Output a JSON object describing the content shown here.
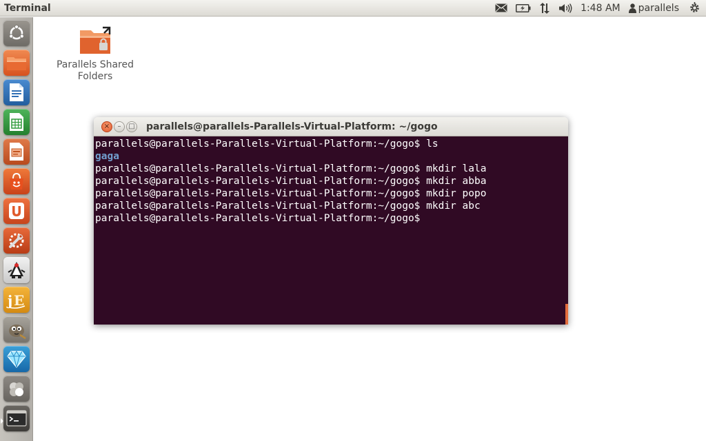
{
  "top_panel": {
    "app_title": "Terminal",
    "clock": "1:48 AM",
    "user": "parallels",
    "icons": [
      "mail-icon",
      "battery-icon",
      "network-icon",
      "volume-icon",
      "user-icon",
      "gear-icon"
    ]
  },
  "launcher": {
    "items": [
      {
        "name": "dash-home",
        "icon": "ubuntu-logo-icon"
      },
      {
        "name": "files",
        "icon": "folder-icon"
      },
      {
        "name": "libreoffice-writer",
        "icon": "document-icon"
      },
      {
        "name": "libreoffice-calc",
        "icon": "spreadsheet-icon"
      },
      {
        "name": "libreoffice-impress",
        "icon": "presentation-icon"
      },
      {
        "name": "software-center",
        "icon": "shopping-bag-icon"
      },
      {
        "name": "ubuntu-one",
        "icon": "u-logo-icon"
      },
      {
        "name": "system-settings",
        "icon": "wrench-icon"
      },
      {
        "name": "java-app",
        "icon": "java-duke-icon"
      },
      {
        "name": "jedit",
        "icon": "je-logo-icon"
      },
      {
        "name": "gimp",
        "icon": "gimp-icon"
      },
      {
        "name": "diamond-app",
        "icon": "diamond-icon"
      },
      {
        "name": "workspace-switcher",
        "icon": "workspaces-icon"
      },
      {
        "name": "terminal",
        "icon": "terminal-icon"
      }
    ],
    "colors": {
      "orange": "#e05a2b",
      "writer_blue": "#2f6fb4",
      "calc_green": "#2f9a3a"
    }
  },
  "desktop": {
    "shared_folder_label": "Parallels Shared Folders"
  },
  "terminal": {
    "title": "parallels@parallels-Parallels-Virtual-Platform: ~/gogo",
    "close_label": "×",
    "minimize_label": "–",
    "maximize_label": "□",
    "background": "#300a24",
    "lines": [
      {
        "text": "parallels@parallels-Parallels-Virtual-Platform:~/gogo$ ls",
        "kind": "prompt"
      },
      {
        "text": "gaga",
        "kind": "dir"
      },
      {
        "text": "parallels@parallels-Parallels-Virtual-Platform:~/gogo$ mkdir lala",
        "kind": "prompt"
      },
      {
        "text": "parallels@parallels-Parallels-Virtual-Platform:~/gogo$ mkdir abba",
        "kind": "prompt"
      },
      {
        "text": "parallels@parallels-Parallels-Virtual-Platform:~/gogo$ mkdir popo",
        "kind": "prompt"
      },
      {
        "text": "parallels@parallels-Parallels-Virtual-Platform:~/gogo$ mkdir abc",
        "kind": "prompt"
      },
      {
        "text": "parallels@parallels-Parallels-Virtual-Platform:~/gogo$",
        "kind": "prompt"
      }
    ]
  }
}
